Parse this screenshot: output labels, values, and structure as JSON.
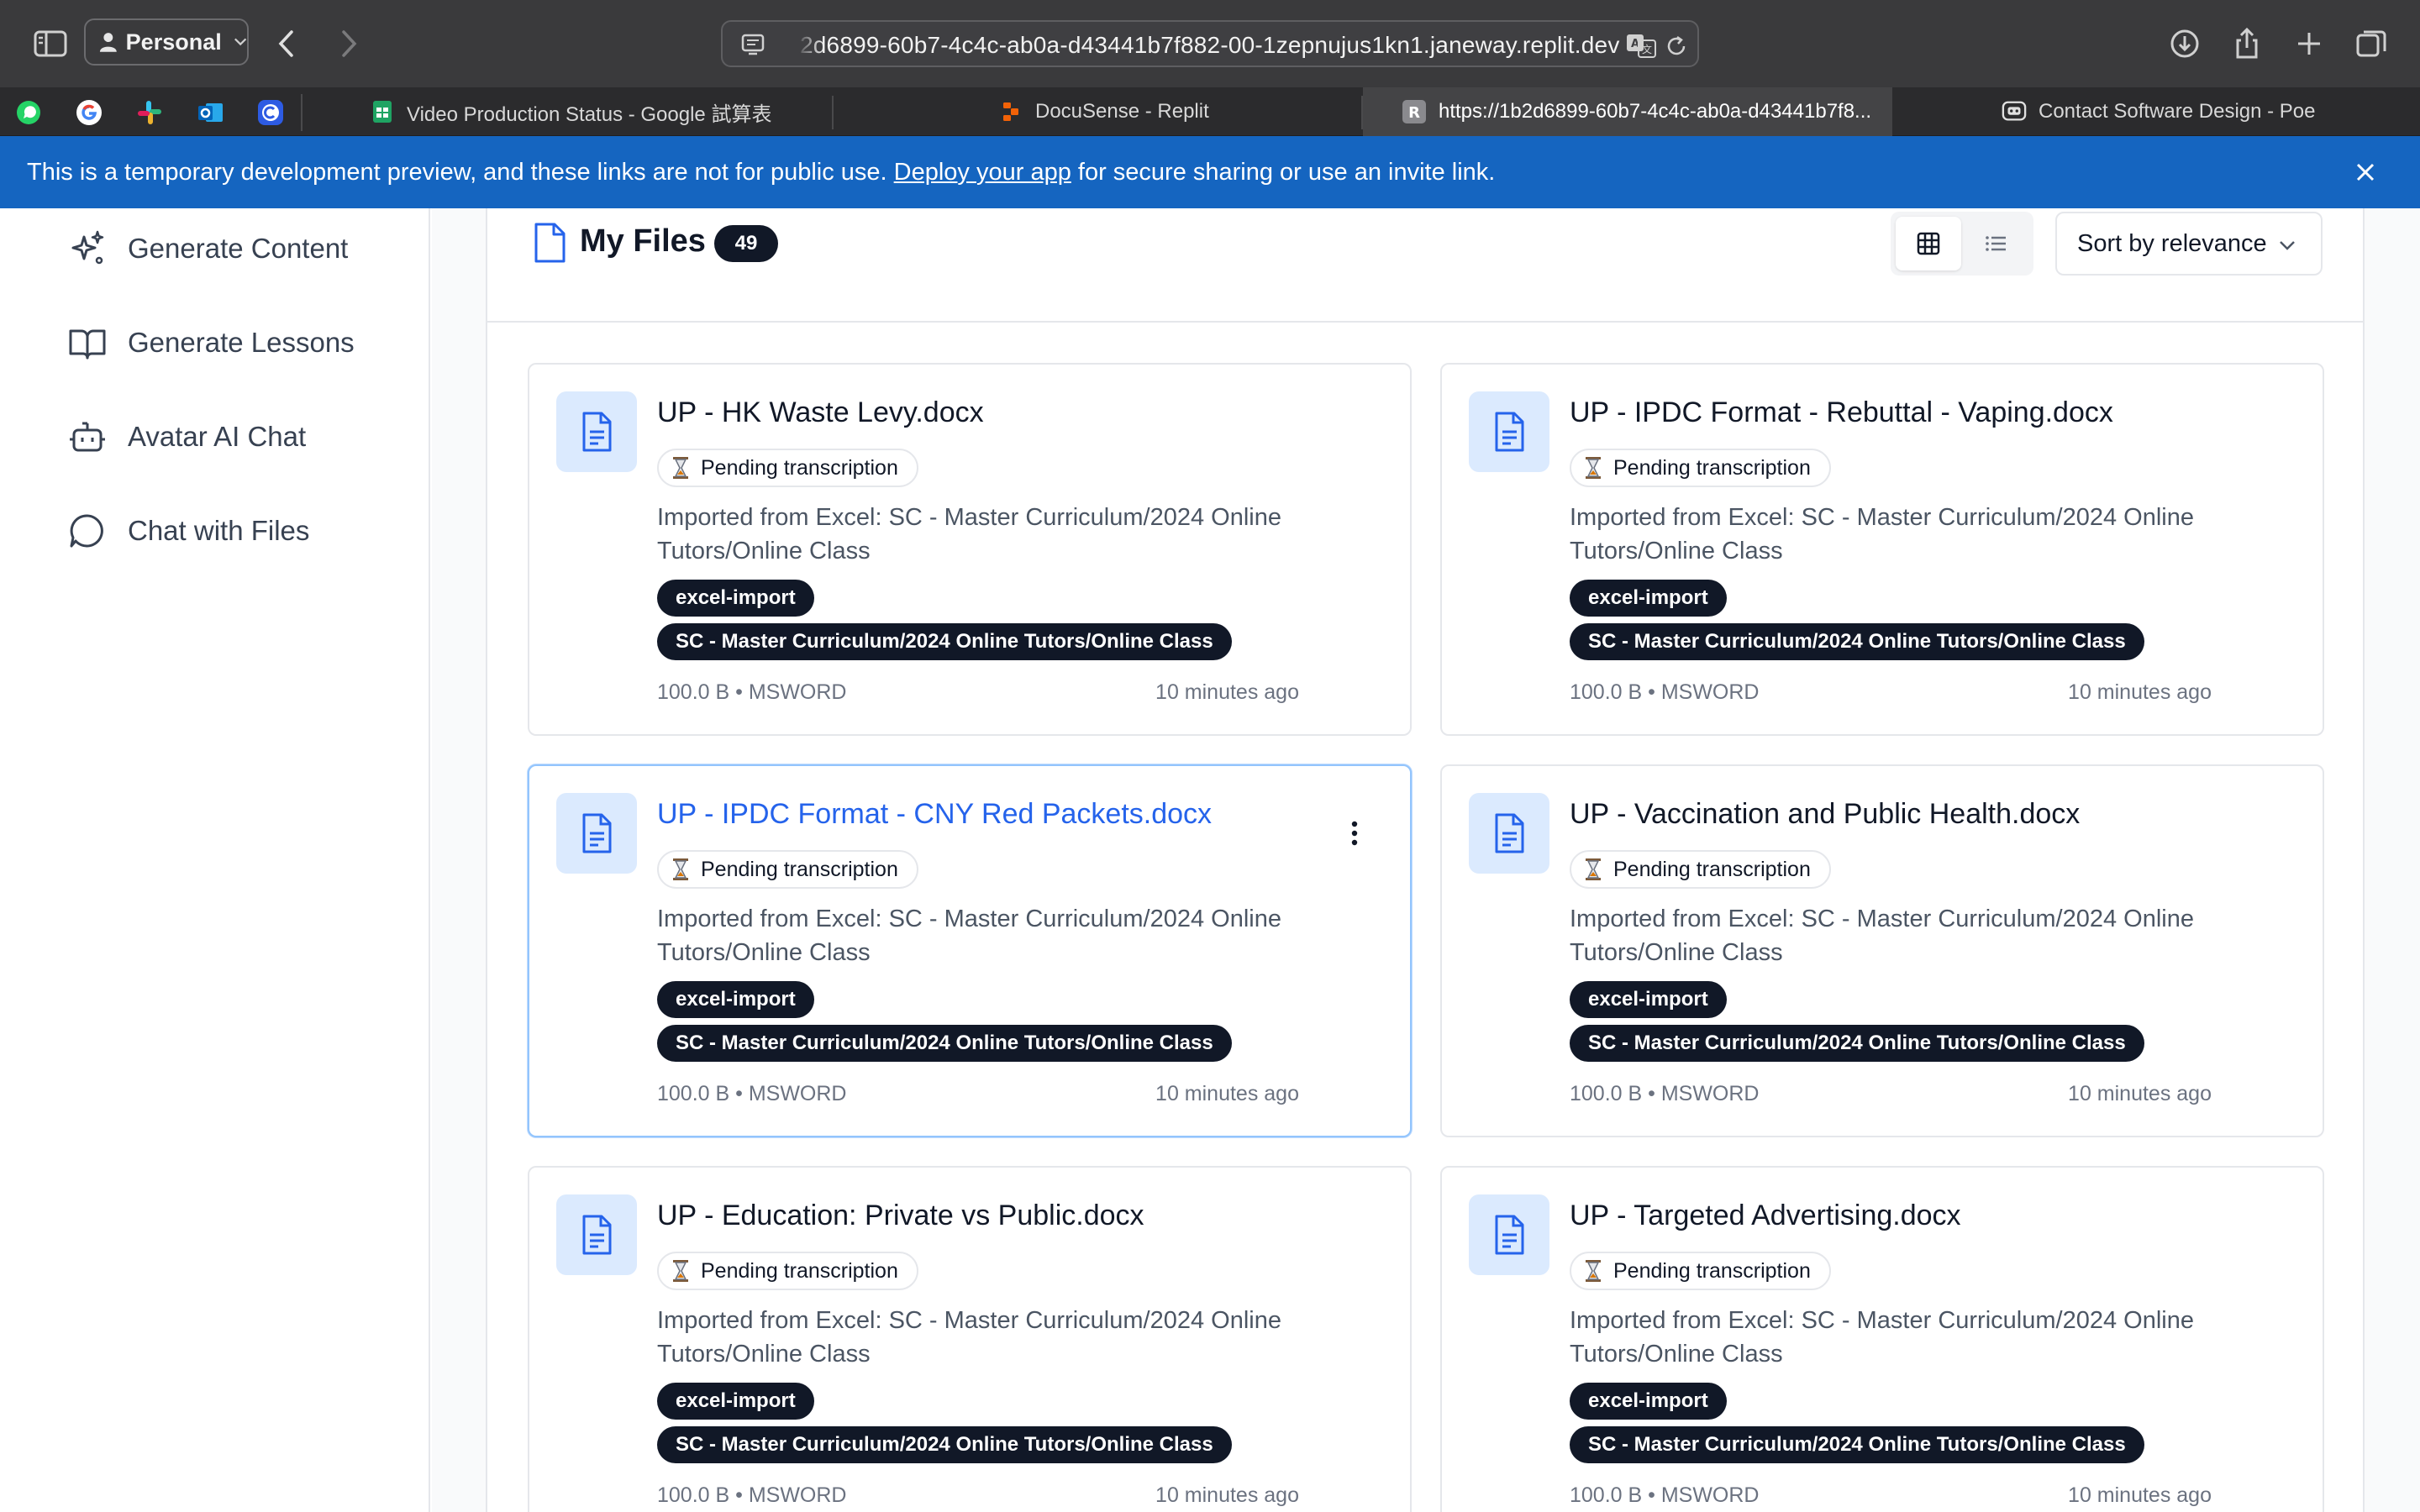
{
  "browser": {
    "profile_label": "Personal",
    "url": "2d6899-60b7-4c4c-ab0a-d43441b7f882-00-1zepnujus1kn1.janeway.replit.dev"
  },
  "tabs": [
    {
      "label": "Video Production Status - Google 試算表",
      "icon": "google-sheets-icon"
    },
    {
      "label": "DocuSense - Replit",
      "icon": "replit-icon"
    },
    {
      "label": "https://1b2d6899-60b7-4c4c-ab0a-d43441b7f8...",
      "icon": "replit-r-icon",
      "active": true
    },
    {
      "label": "Contact Software Design - Poe",
      "icon": "poe-icon"
    }
  ],
  "pinned_tabs": [
    "whatsapp-icon",
    "google-icon",
    "slack-icon",
    "outlook-icon",
    "canva-icon"
  ],
  "banner": {
    "text_before": "This is a temporary development preview, and these links are not for public use. ",
    "link": "Deploy your app",
    "text_after": " for secure sharing or use an invite link."
  },
  "sidebar": {
    "items": [
      {
        "label": "Generate Content",
        "icon": "sparkles-icon"
      },
      {
        "label": "Generate Lessons",
        "icon": "book-open-icon"
      },
      {
        "label": "Avatar AI Chat",
        "icon": "bot-icon"
      },
      {
        "label": "Chat with Files",
        "icon": "chat-bubble-icon"
      }
    ]
  },
  "files": {
    "title": "My Files",
    "count": "49",
    "sort_label": "Sort by relevance",
    "view_mode": "grid",
    "items": [
      {
        "name": "UP - HK Waste Levy.docx",
        "status": "Pending transcription",
        "desc": "Imported from Excel: SC - Master Curriculum/2024 Online Tutors/Online Class",
        "tags": [
          "excel-import",
          "SC - Master Curriculum/2024 Online Tutors/Online Class"
        ],
        "meta": "100.0 B • MSWORD",
        "time": "10 minutes ago"
      },
      {
        "name": "UP - IPDC Format - Rebuttal - Vaping.docx",
        "status": "Pending transcription",
        "desc": "Imported from Excel: SC - Master Curriculum/2024 Online Tutors/Online Class",
        "tags": [
          "excel-import",
          "SC - Master Curriculum/2024 Online Tutors/Online Class"
        ],
        "meta": "100.0 B • MSWORD",
        "time": "10 minutes ago"
      },
      {
        "name": "UP - IPDC Format - CNY Red Packets.docx",
        "status": "Pending transcription",
        "desc": "Imported from Excel: SC - Master Curriculum/2024 Online Tutors/Online Class",
        "tags": [
          "excel-import",
          "SC - Master Curriculum/2024 Online Tutors/Online Class"
        ],
        "meta": "100.0 B • MSWORD",
        "time": "10 minutes ago",
        "selected": true
      },
      {
        "name": "UP - Vaccination and Public Health.docx",
        "status": "Pending transcription",
        "desc": "Imported from Excel: SC - Master Curriculum/2024 Online Tutors/Online Class",
        "tags": [
          "excel-import",
          "SC - Master Curriculum/2024 Online Tutors/Online Class"
        ],
        "meta": "100.0 B • MSWORD",
        "time": "10 minutes ago"
      },
      {
        "name": "UP - Education: Private vs Public.docx",
        "status": "Pending transcription",
        "desc": "Imported from Excel: SC - Master Curriculum/2024 Online Tutors/Online Class",
        "tags": [
          "excel-import",
          "SC - Master Curriculum/2024 Online Tutors/Online Class"
        ],
        "meta": "100.0 B • MSWORD",
        "time": "10 minutes ago"
      },
      {
        "name": "UP - Targeted Advertising.docx",
        "status": "Pending transcription",
        "desc": "Imported from Excel: SC - Master Curriculum/2024 Online Tutors/Online Class",
        "tags": [
          "excel-import",
          "SC - Master Curriculum/2024 Online Tutors/Online Class"
        ],
        "meta": "100.0 B • MSWORD",
        "time": "10 minutes ago"
      }
    ]
  },
  "colors": {
    "banner": "#1565c0",
    "accent": "#2563eb",
    "tag_bg": "#111827",
    "icon_tile": "#dbeafe"
  }
}
